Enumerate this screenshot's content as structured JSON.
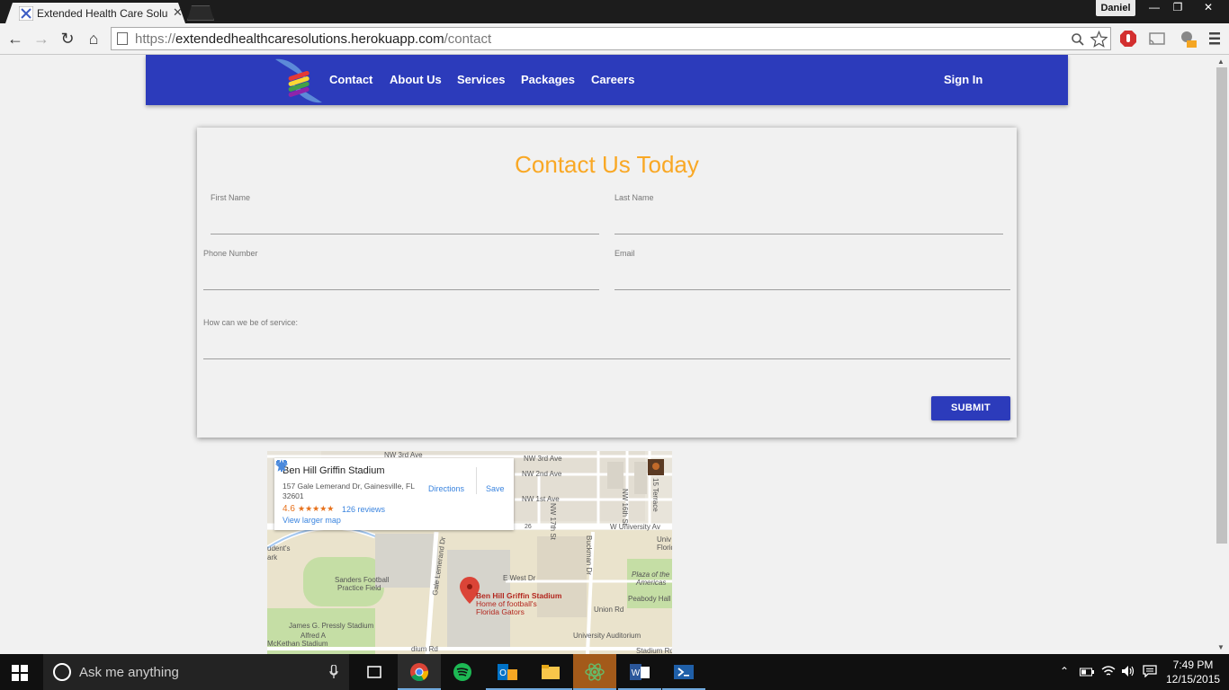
{
  "browser": {
    "tab_title": "Extended Health Care Solu",
    "tab_close": "✕",
    "profile_name": "Daniel",
    "window_controls": {
      "minimize": "—",
      "restore": "❐",
      "close": "✕"
    },
    "nav": {
      "back": "←",
      "forward": "→",
      "reload": "↻",
      "home": "⌂"
    },
    "url_scheme": "https://",
    "url_host": "extendedhealthcaresolutions.herokuapp.com",
    "url_path": "/contact",
    "icons": {
      "search": "search-icon",
      "star": "star-icon",
      "menu": "menu-icon"
    }
  },
  "site": {
    "brand_color": "#2c3bbb",
    "accent_color": "#f9a825",
    "nav": {
      "contact": "Contact",
      "about": "About Us",
      "services": "Services",
      "packages": "Packages",
      "careers": "Careers",
      "sign_in": "Sign In"
    },
    "form": {
      "title": "Contact Us Today",
      "first_name": "First Name",
      "last_name": "Last Name",
      "phone": "Phone Number",
      "email": "Email",
      "message": "How can we be of service:",
      "submit": "SUBMIT"
    },
    "map": {
      "place_name": "Ben Hill Griffin Stadium",
      "address": "157 Gale Lemerand Dr, Gainesville, FL 32601",
      "rating": "4.6",
      "stars": "★★★★★",
      "reviews": "126 reviews",
      "view_larger": "View larger map",
      "directions": "Directions",
      "save": "Save",
      "pin_title": "Ben Hill Griffin Stadium",
      "pin_sub1": "Home of football's",
      "pin_sub2": "Florida Gators",
      "labels": {
        "nw3rd_a": "NW 3rd Ave",
        "nw3rd_b": "NW 3rd Ave",
        "nw2nd": "NW 2nd Ave",
        "nw1st": "NW 1st Ave",
        "nw17th": "NW 17th St",
        "nw16th": "NW 16th St",
        "terrace": "15 Terrace",
        "univ_ave": "W University Av",
        "route": "26",
        "e_west": "E West Dr",
        "buckman": "Buckman Dr",
        "gale": "Gale Lemerand Dr",
        "sanders": "Sanders Football",
        "practice": "Practice Field",
        "plaza1": "Plaza of the",
        "plaza2": "Americas",
        "peabody": "Peabody Hall",
        "union": "Union Rd",
        "pressly": "James G. Pressly Stadium",
        "alfred1": "Alfred A",
        "alfred2": "McKethan Stadium",
        "univ_aud": "University Auditorium",
        "stadium_rd": "Stadium Rd",
        "dium_rd": "dium Rd",
        "students": "udent's",
        "park": "ark",
        "florida": "Florid",
        "univ": "Univ"
      }
    }
  },
  "taskbar": {
    "search_placeholder": "Ask me anything",
    "time": "7:49 PM",
    "date": "12/15/2015",
    "apps": [
      "task-view",
      "chrome",
      "spotify",
      "outlook",
      "file-explorer",
      "atom",
      "word",
      "powershell"
    ]
  }
}
